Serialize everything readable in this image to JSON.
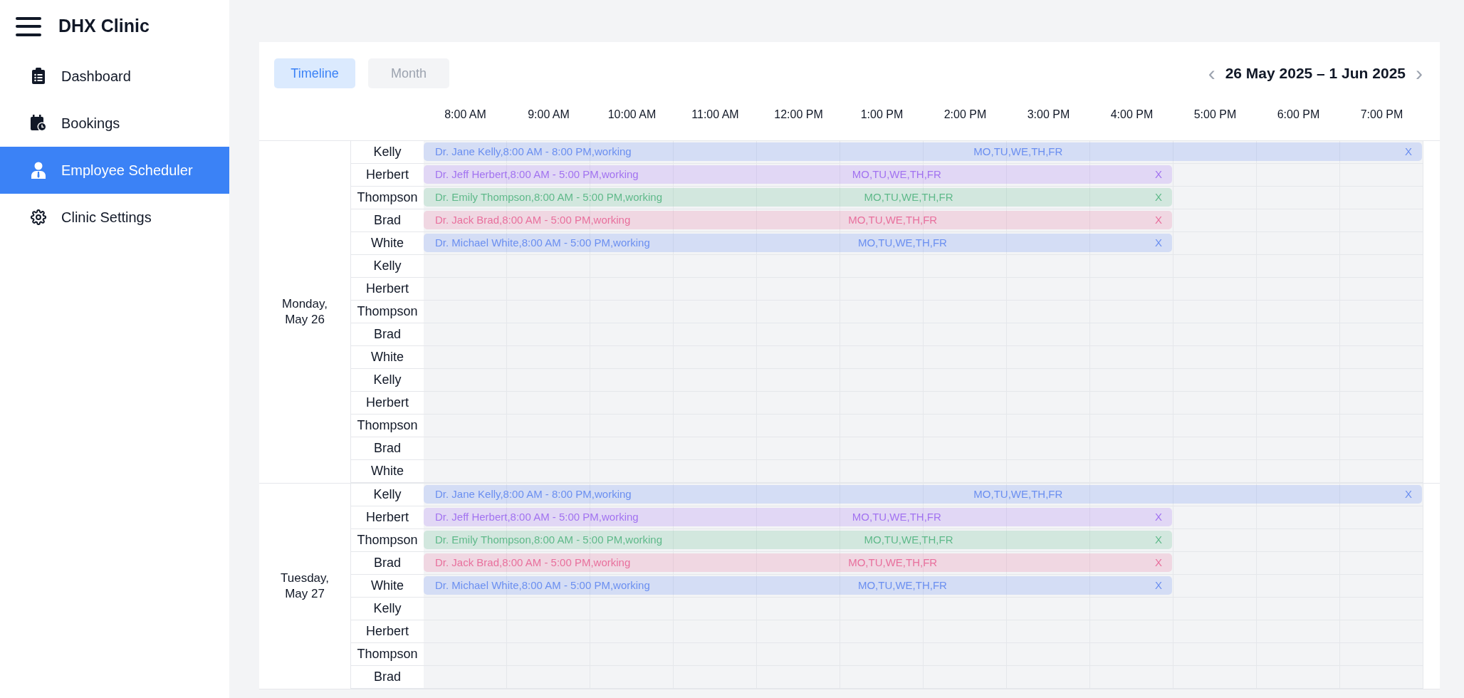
{
  "sidebar": {
    "title": "DHX Clinic",
    "items": [
      {
        "label": "Dashboard",
        "kind": "clipboard",
        "selected": false
      },
      {
        "label": "Bookings",
        "kind": "calendar",
        "selected": false
      },
      {
        "label": "Employee Scheduler",
        "kind": "person",
        "selected": true
      },
      {
        "label": "Clinic Settings",
        "kind": "gear",
        "selected": false
      }
    ]
  },
  "scheduler": {
    "tabs": [
      {
        "label": "Timeline",
        "selected": true
      },
      {
        "label": "Month",
        "selected": false
      }
    ],
    "prev": "‹",
    "date_range": "26 May 2025 – 1 Jun 2025",
    "next": "›",
    "times": [
      "8:00 AM",
      "9:00 AM",
      "10:00 AM",
      "11:00 AM",
      "12:00 PM",
      "1:00 PM",
      "2:00 PM",
      "3:00 PM",
      "4:00 PM",
      "5:00 PM",
      "6:00 PM",
      "7:00 PM"
    ],
    "days": [
      {
        "label": "Monday, May 26",
        "rows": [
          {
            "name": "Kelly",
            "event": {
              "text": "Dr. Jane Kelly,8:00 AM - 8:00 PM,working",
              "days": "MO,TU,WE,TH,FR",
              "close": "X",
              "color": "#6b8ff0",
              "kind": "long"
            }
          },
          {
            "name": "Herbert",
            "event": {
              "text": "Dr. Jeff Herbert,8:00 AM - 5:00 PM,working",
              "days": "MO,TU,WE,TH,FR",
              "close": "X",
              "color": "#a273f0",
              "kind": "standard"
            }
          },
          {
            "name": "Thompson",
            "event": {
              "text": "Dr. Emily Thompson,8:00 AM - 5:00 PM,working",
              "days": "MO,TU,WE,TH,FR",
              "close": "X",
              "color": "#5fb98a",
              "kind": "standard"
            }
          },
          {
            "name": "Brad",
            "event": {
              "text": "Dr. Jack Brad,8:00 AM - 5:00 PM,working",
              "days": "MO,TU,WE,TH,FR",
              "close": "X",
              "color": "#e8709d",
              "kind": "standard"
            }
          },
          {
            "name": "White",
            "event": {
              "text": "Dr. Michael White,8:00 AM - 5:00 PM,working",
              "days": "MO,TU,WE,TH,FR",
              "close": "X",
              "color": "#6b8ff0",
              "kind": "standard"
            }
          },
          {
            "name": "Kelly"
          },
          {
            "name": "Herbert"
          },
          {
            "name": "Thompson"
          },
          {
            "name": "Brad"
          },
          {
            "name": "White"
          },
          {
            "name": "Kelly"
          },
          {
            "name": "Herbert"
          },
          {
            "name": "Thompson"
          },
          {
            "name": "Brad"
          },
          {
            "name": "White"
          }
        ]
      },
      {
        "label": "Tuesday, May 27",
        "rows": [
          {
            "name": "Kelly",
            "event": {
              "text": "Dr. Jane Kelly,8:00 AM - 8:00 PM,working",
              "days": "MO,TU,WE,TH,FR",
              "close": "X",
              "color": "#6b8ff0",
              "kind": "long"
            }
          },
          {
            "name": "Herbert",
            "event": {
              "text": "Dr. Jeff Herbert,8:00 AM - 5:00 PM,working",
              "days": "MO,TU,WE,TH,FR",
              "close": "X",
              "color": "#a273f0",
              "kind": "standard"
            }
          },
          {
            "name": "Thompson",
            "event": {
              "text": "Dr. Emily Thompson,8:00 AM - 5:00 PM,working",
              "days": "MO,TU,WE,TH,FR",
              "close": "X",
              "color": "#5fb98a",
              "kind": "standard"
            }
          },
          {
            "name": "Brad",
            "event": {
              "text": "Dr. Jack Brad,8:00 AM - 5:00 PM,working",
              "days": "MO,TU,WE,TH,FR",
              "close": "X",
              "color": "#e8709d",
              "kind": "standard"
            }
          },
          {
            "name": "White",
            "event": {
              "text": "Dr. Michael White,8:00 AM - 5:00 PM,working",
              "days": "MO,TU,WE,TH,FR",
              "close": "X",
              "color": "#6b8ff0",
              "kind": "standard"
            }
          },
          {
            "name": "Kelly"
          },
          {
            "name": "Herbert"
          },
          {
            "name": "Thompson"
          },
          {
            "name": "Brad"
          }
        ]
      }
    ]
  }
}
